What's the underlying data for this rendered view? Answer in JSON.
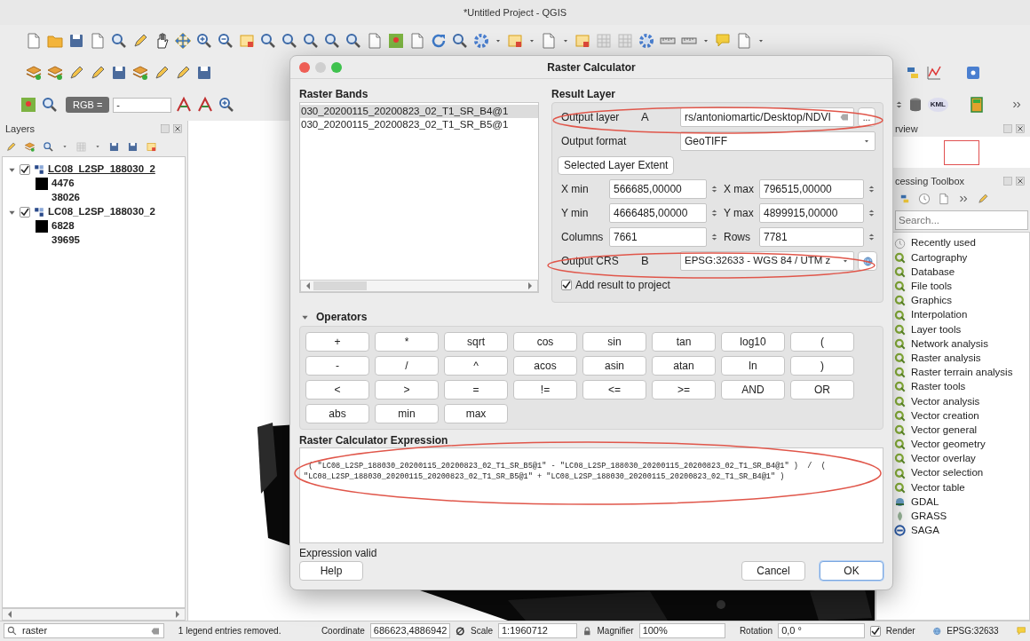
{
  "window": {
    "title": "*Untitled Project - QGIS"
  },
  "toolbar": {
    "style_combo": "RGB =",
    "band_combo": "-",
    "kml_label": "KML"
  },
  "layers_panel": {
    "title": "Layers",
    "layers": [
      {
        "name": "LC08_L2SP_188030_2",
        "checked": true,
        "expanded": true,
        "selected": true,
        "children": [
          {
            "kind": "swatch",
            "label": "4476"
          },
          {
            "kind": "value",
            "label": "38026"
          }
        ]
      },
      {
        "name": "LC08_L2SP_188030_2",
        "checked": true,
        "expanded": true,
        "selected": false,
        "children": [
          {
            "kind": "swatch",
            "label": "6828"
          },
          {
            "kind": "value",
            "label": "39695"
          }
        ]
      }
    ],
    "search": {
      "value": "raster"
    }
  },
  "overview_panel": {
    "title": "rview"
  },
  "toolbox": {
    "title": "cessing Toolbox",
    "search": {
      "placeholder": "Search..."
    },
    "items": [
      {
        "kind": "recent",
        "label": "Recently used"
      },
      {
        "kind": "qgis",
        "label": "Cartography"
      },
      {
        "kind": "qgis",
        "label": "Database"
      },
      {
        "kind": "qgis",
        "label": "File tools"
      },
      {
        "kind": "qgis",
        "label": "Graphics"
      },
      {
        "kind": "qgis",
        "label": "Interpolation"
      },
      {
        "kind": "qgis",
        "label": "Layer tools"
      },
      {
        "kind": "qgis",
        "label": "Network analysis"
      },
      {
        "kind": "qgis",
        "label": "Raster analysis"
      },
      {
        "kind": "qgis",
        "label": "Raster terrain analysis"
      },
      {
        "kind": "qgis",
        "label": "Raster tools"
      },
      {
        "kind": "qgis",
        "label": "Vector analysis"
      },
      {
        "kind": "qgis",
        "label": "Vector creation"
      },
      {
        "kind": "qgis",
        "label": "Vector general"
      },
      {
        "kind": "qgis",
        "label": "Vector geometry"
      },
      {
        "kind": "qgis",
        "label": "Vector overlay"
      },
      {
        "kind": "qgis",
        "label": "Vector selection"
      },
      {
        "kind": "qgis",
        "label": "Vector table"
      },
      {
        "kind": "gdal",
        "label": "GDAL"
      },
      {
        "kind": "grass",
        "label": "GRASS"
      },
      {
        "kind": "saga",
        "label": "SAGA"
      }
    ]
  },
  "dialog": {
    "title": "Raster Calculator",
    "bands": {
      "title": "Raster Bands",
      "items": [
        {
          "label": "030_20200115_20200823_02_T1_SR_B4@1",
          "selected": true
        },
        {
          "label": "030_20200115_20200823_02_T1_SR_B5@1",
          "selected": false
        }
      ]
    },
    "result": {
      "title": "Result Layer",
      "output_layer": {
        "label": "Output layer",
        "marker": "A",
        "value": "rs/antoniomartic/Desktop/NDVI",
        "browse": "..."
      },
      "output_format": {
        "label": "Output format",
        "value": "GeoTIFF"
      },
      "extent_button": "Selected Layer Extent",
      "fields": [
        {
          "label": "X min",
          "value": "566685,00000",
          "label2": "X max",
          "value2": "796515,00000"
        },
        {
          "label": "Y min",
          "value": "4666485,00000",
          "label2": "Y max",
          "value2": "4899915,00000"
        },
        {
          "label": "Columns",
          "value": "7661",
          "label2": "Rows",
          "value2": "7781"
        }
      ],
      "output_crs": {
        "label": "Output CRS",
        "marker": "B",
        "value": "EPSG:32633 - WGS 84 / UTM z"
      },
      "add_to_project": {
        "label": "Add result to project",
        "checked": true
      }
    },
    "operators": {
      "title": "Operators",
      "expanded": true,
      "buttons": [
        "+",
        "*",
        "sqrt",
        "cos",
        "sin",
        "tan",
        "log10",
        "(",
        "-",
        "/",
        "^",
        "acos",
        "asin",
        "atan",
        "ln",
        ")",
        "<",
        ">",
        "=",
        "!=",
        "<=",
        ">=",
        "AND",
        "OR",
        "abs",
        "min",
        "max"
      ]
    },
    "expression": {
      "title": "Raster Calculator Expression",
      "lines": [
        " ( \"LC08_L2SP_188030_20200115_20200823_02_T1_SR_B5@1\" - \"LC08_L2SP_188030_20200115_20200823_02_T1_SR_B4@1\" )  /  (",
        "\"LC08_L2SP_188030_20200115_20200823_02_T1_SR_B5@1\" + \"LC08_L2SP_188030_20200115_20200823_02_T1_SR_B4@1\" )"
      ]
    },
    "status": "Expression valid",
    "buttons": [
      {
        "label": "Help",
        "kind": "help"
      },
      {
        "label": "Cancel",
        "kind": "cancel"
      },
      {
        "label": "OK",
        "kind": "default"
      }
    ]
  },
  "status_bar": {
    "message": "1 legend entries removed.",
    "coordinate_label": "Coordinate",
    "coordinate": "686623,4886942",
    "scale_label": "Scale",
    "scale": "1:1960712",
    "magnifier_label": "Magnifier",
    "magnifier": "100%",
    "rotation_label": "Rotation",
    "rotation": "0,0 °",
    "render": {
      "label": "Render",
      "checked": true
    },
    "crs": "EPSG:32633"
  }
}
